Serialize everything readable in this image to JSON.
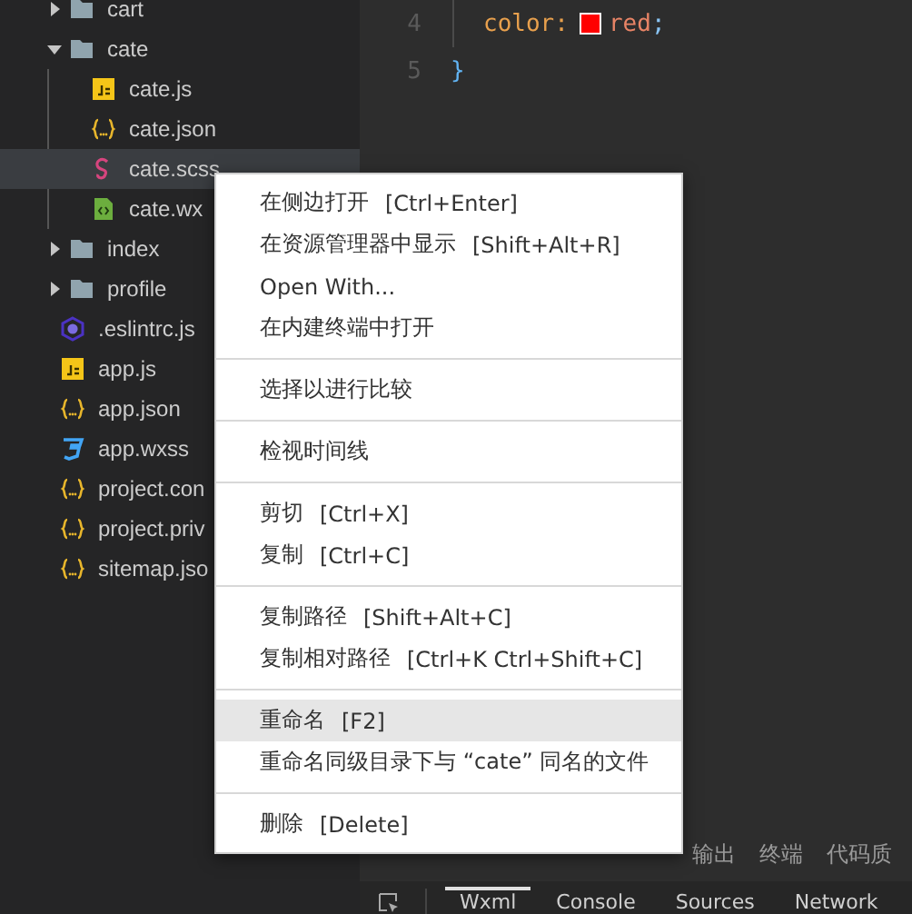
{
  "explorer": {
    "items": [
      {
        "kind": "folder",
        "label": "cart",
        "expanded": false,
        "selected": false
      },
      {
        "kind": "folder",
        "label": "cate",
        "expanded": true,
        "selected": false,
        "children": [
          {
            "kind": "js",
            "label": "cate.js",
            "selected": false
          },
          {
            "kind": "json",
            "label": "cate.json",
            "selected": false
          },
          {
            "kind": "scss",
            "label": "cate.scss",
            "selected": true
          },
          {
            "kind": "wxml",
            "label": "cate.wx",
            "selected": false
          }
        ]
      },
      {
        "kind": "folder",
        "label": "index",
        "expanded": false,
        "selected": false
      },
      {
        "kind": "folder",
        "label": "profile",
        "expanded": false,
        "selected": false
      }
    ],
    "root_files": [
      {
        "kind": "eslint",
        "label": ".eslintrc.js",
        "selected": false
      },
      {
        "kind": "js",
        "label": "app.js",
        "selected": false
      },
      {
        "kind": "json",
        "label": "app.json",
        "selected": false
      },
      {
        "kind": "wxss",
        "label": "app.wxss",
        "selected": false
      },
      {
        "kind": "json",
        "label": "project.con",
        "selected": false
      },
      {
        "kind": "json",
        "label": "project.priv",
        "selected": false
      },
      {
        "kind": "json",
        "label": "sitemap.jso",
        "selected": false
      }
    ]
  },
  "editor": {
    "lines": [
      {
        "number": "4",
        "indented": true,
        "tokens": [
          {
            "kind": "property",
            "text": "color:"
          },
          {
            "kind": "swatch",
            "color": "#ff0000"
          },
          {
            "kind": "value",
            "text": "red"
          },
          {
            "kind": "punct",
            "text": ";"
          }
        ]
      },
      {
        "number": "5",
        "indented": false,
        "tokens": [
          {
            "kind": "brace",
            "text": "}"
          }
        ]
      }
    ]
  },
  "context_menu": {
    "groups": [
      [
        {
          "label": "在侧边打开",
          "shortcut": "[Ctrl+Enter]",
          "selected": false
        },
        {
          "label": "在资源管理器中显示",
          "shortcut": "[Shift+Alt+R]",
          "selected": false
        },
        {
          "label": "Open With...",
          "selected": false
        },
        {
          "label": "在内建终端中打开",
          "selected": false
        }
      ],
      [
        {
          "label": "选择以进行比较",
          "selected": false
        }
      ],
      [
        {
          "label": "检视时间线",
          "selected": false
        }
      ],
      [
        {
          "label": "剪切",
          "shortcut": "[Ctrl+X]",
          "selected": false
        },
        {
          "label": "复制",
          "shortcut": "[Ctrl+C]",
          "selected": false
        }
      ],
      [
        {
          "label": "复制路径",
          "shortcut": "[Shift+Alt+C]",
          "selected": false
        },
        {
          "label": "复制相对路径",
          "shortcut": "[Ctrl+K Ctrl+Shift+C]",
          "selected": false
        }
      ],
      [
        {
          "label": "重命名",
          "shortcut": "[F2]",
          "selected": true
        },
        {
          "label": "重命名同级目录下与 “cate” 同名的文件",
          "selected": false
        }
      ],
      [
        {
          "label": "删除",
          "shortcut": "[Delete]",
          "selected": false
        }
      ]
    ]
  },
  "panel_tabs": [
    {
      "label": "输出"
    },
    {
      "label": "终端"
    },
    {
      "label": "代码质"
    }
  ],
  "devtools_tabs": [
    {
      "label": "Wxml",
      "selected": true
    },
    {
      "label": "Console",
      "selected": false
    },
    {
      "label": "Sources",
      "selected": false
    },
    {
      "label": "Network",
      "selected": false
    }
  ]
}
